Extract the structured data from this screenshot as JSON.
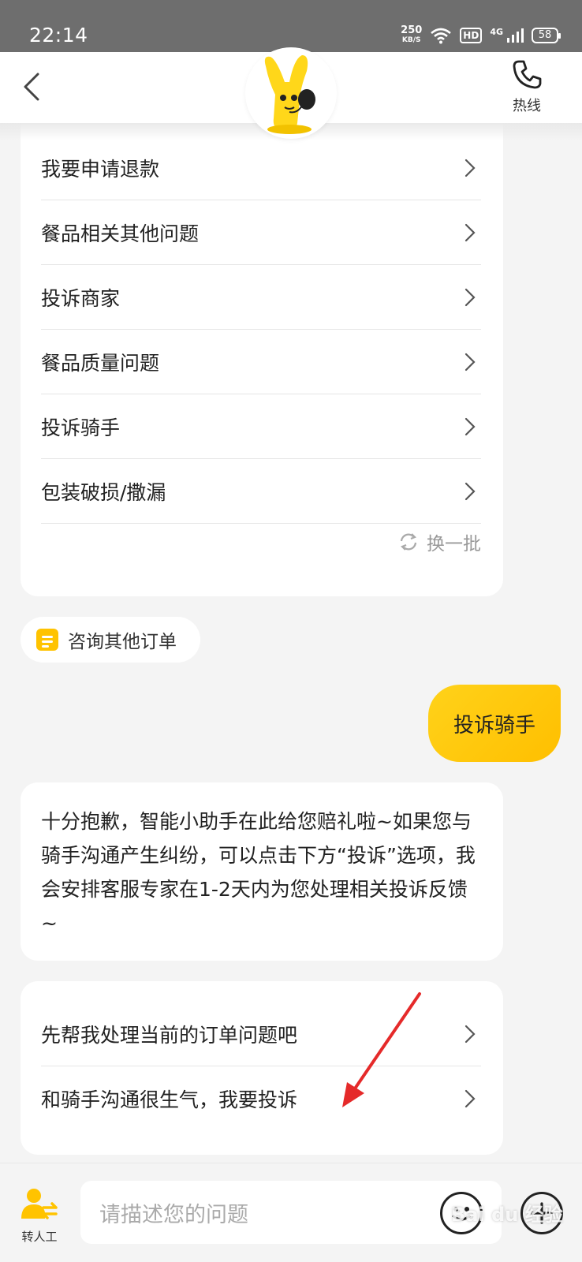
{
  "status_bar": {
    "time": "22:14",
    "speed": "250",
    "speed_unit": "KB/S",
    "hd": "HD",
    "network": "4G",
    "battery": "58"
  },
  "header": {
    "hotline_label": "热线"
  },
  "topics": {
    "items": [
      "我要申请退款",
      "餐品相关其他问题",
      "投诉商家",
      "餐品质量问题",
      "投诉骑手",
      "包装破损/撒漏"
    ],
    "refresh_label": "换一批"
  },
  "other_order_label": "咨询其他订单",
  "user_message": "投诉骑手",
  "bot_reply": "十分抱歉，智能小助手在此给您赔礼啦~如果您与骑手沟通产生纠纷，可以点击下方“投诉”选项，我会安排客服专家在1-2天内为您处理相关投诉反馈~",
  "options": [
    "先帮我处理当前的订单问题吧",
    "和骑手沟通很生气，我要投诉"
  ],
  "bottom_bar": {
    "transfer_label": "转人工",
    "input_placeholder": "请描述您的问题"
  },
  "watermark": "Bai du 经验",
  "colors": {
    "accent": "#ffc300",
    "annotation_arrow": "#e52a2a"
  }
}
